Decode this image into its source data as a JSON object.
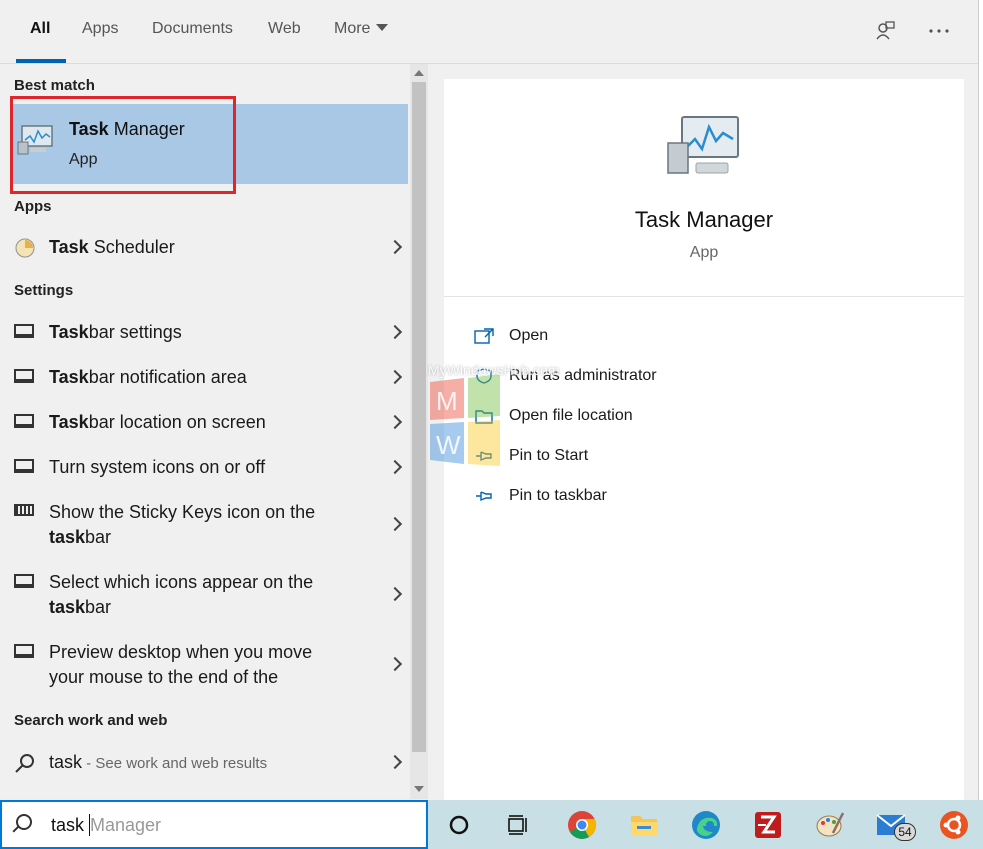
{
  "tabs": [
    {
      "label": "All"
    },
    {
      "label": "Apps"
    },
    {
      "label": "Documents"
    },
    {
      "label": "Web"
    },
    {
      "label": "More"
    }
  ],
  "sections": {
    "best_match": "Best match",
    "apps": "Apps",
    "settings": "Settings",
    "search_web": "Search work and web"
  },
  "best_match": {
    "title_bold": "Task",
    "title_rest": " Manager",
    "subtitle": "App"
  },
  "apps": [
    {
      "bold": "Task",
      "rest": " Scheduler"
    }
  ],
  "settings": [
    {
      "bold": "Task",
      "rest": "bar settings"
    },
    {
      "bold": "Task",
      "rest": "bar notification area"
    },
    {
      "bold": "Task",
      "rest": "bar location on screen"
    },
    {
      "line1": "Turn system icons on or off"
    },
    {
      "line1": "Show the Sticky Keys icon on the",
      "bold": "task",
      "rest": "bar"
    },
    {
      "line1": "Select which icons appear on the",
      "bold": "task",
      "rest": "bar"
    },
    {
      "line1": "Preview desktop when you move",
      "line2": "your mouse to the end of the"
    }
  ],
  "web": {
    "query": "task",
    "hint": " - See work and web results"
  },
  "detail": {
    "name": "Task Manager",
    "kind": "App",
    "actions": [
      {
        "label": "Open"
      },
      {
        "label": "Run as administrator"
      },
      {
        "label": "Open file location"
      },
      {
        "label": "Pin to Start"
      },
      {
        "label": "Pin to taskbar"
      }
    ]
  },
  "watermark": {
    "text": "MyWindowsHub.com",
    "letters": [
      "M",
      "W"
    ]
  },
  "search": {
    "typed": "task",
    "suggestion": "Manager"
  },
  "taskbar": {
    "mail_badge": "54"
  },
  "colors": {
    "accent": "#0063b1",
    "highlight": "#a8c8e6",
    "frame": "#e0262d"
  }
}
